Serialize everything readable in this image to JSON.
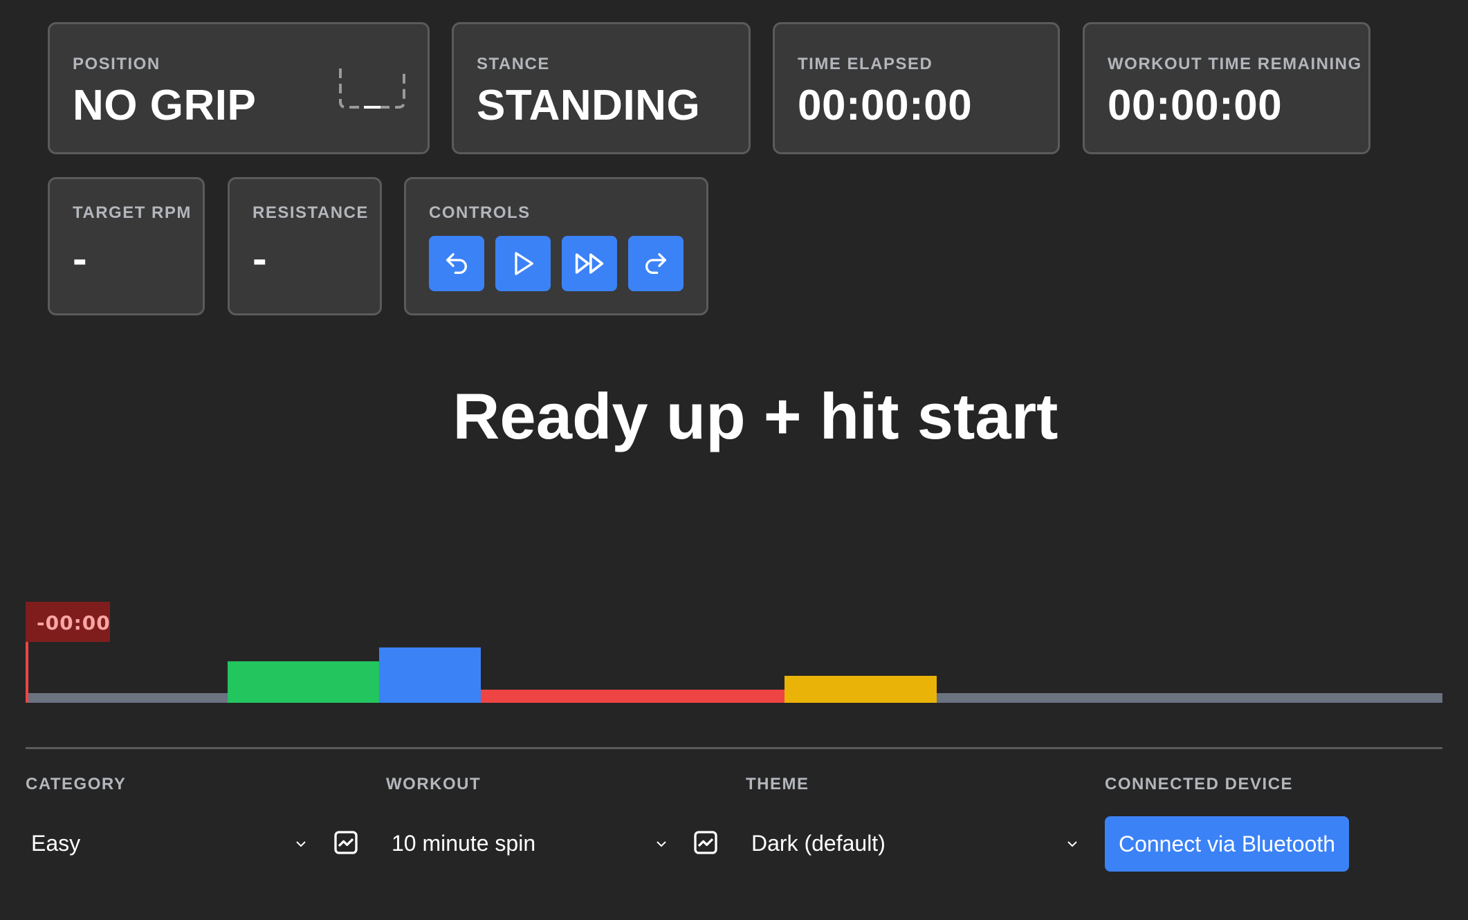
{
  "stats": {
    "position": {
      "label": "POSITION",
      "value": "NO GRIP",
      "icon": "no-grip-icon"
    },
    "stance": {
      "label": "STANCE",
      "value": "STANDING"
    },
    "time_elapsed": {
      "label": "TIME ELAPSED",
      "value": "00:00:00"
    },
    "time_remaining": {
      "label": "WORKOUT TIME REMAINING",
      "value": "00:00:00"
    },
    "target_rpm": {
      "label": "TARGET RPM",
      "value": "-"
    },
    "resistance": {
      "label": "RESISTANCE",
      "value": "-"
    }
  },
  "controls": {
    "label": "CONTROLS",
    "buttons": [
      "undo-icon",
      "play-icon",
      "fast-forward-icon",
      "redo-icon"
    ]
  },
  "headline": "Ready up + hit start",
  "timeline": {
    "badge": "-00:00",
    "colors": {
      "green": "#22c55e",
      "blue": "#3b82f6",
      "red": "#ef4444",
      "yellow": "#eab308",
      "gray": "#6b7280"
    }
  },
  "settings": {
    "category": {
      "label": "CATEGORY",
      "value": "Easy"
    },
    "workout": {
      "label": "WORKOUT",
      "value": "10 minute spin"
    },
    "theme": {
      "label": "THEME",
      "value": "Dark (default)"
    },
    "device": {
      "label": "CONNECTED DEVICE",
      "button": "Connect via Bluetooth"
    }
  },
  "colors": {
    "background": "#252525",
    "card": "#393939",
    "card_border": "#5b5b5b",
    "accent": "#3b82f6",
    "label": "#b3b6bb"
  }
}
